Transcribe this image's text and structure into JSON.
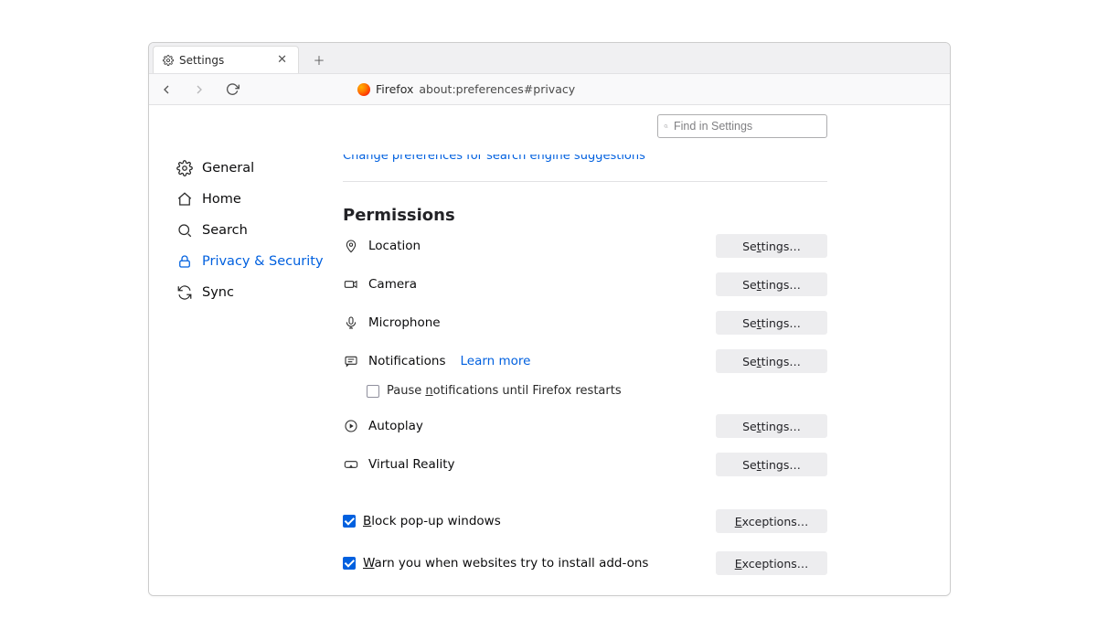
{
  "tab": {
    "title": "Settings"
  },
  "url": {
    "brandLabel": "Firefox",
    "address": "about:preferences#privacy"
  },
  "search": {
    "placeholder": "Find in Settings"
  },
  "sidebar": {
    "items": [
      {
        "label": "General"
      },
      {
        "label": "Home"
      },
      {
        "label": "Search"
      },
      {
        "label": "Privacy & Security"
      },
      {
        "label": "Sync"
      }
    ]
  },
  "topLink": "Change preferences for search engine suggestions",
  "sectionTitle": "Permissions",
  "permissions": {
    "location": {
      "label": "Location",
      "button": "Settings…"
    },
    "camera": {
      "label": "Camera",
      "button": "Settings…"
    },
    "microphone": {
      "label": "Microphone",
      "button": "Settings…"
    },
    "notifications": {
      "label": "Notifications",
      "button": "Settings…",
      "learn": "Learn more"
    },
    "pause": {
      "label": "Pause notifications until Firefox restarts"
    },
    "autoplay": {
      "label": "Autoplay",
      "button": "Settings…"
    },
    "vr": {
      "label": "Virtual Reality",
      "button": "Settings…"
    }
  },
  "popups": {
    "block": {
      "label": "Block pop-up windows",
      "button": "Exceptions…"
    },
    "warn": {
      "label": "Warn you when websites try to install add-ons",
      "button": "Exceptions…"
    }
  }
}
